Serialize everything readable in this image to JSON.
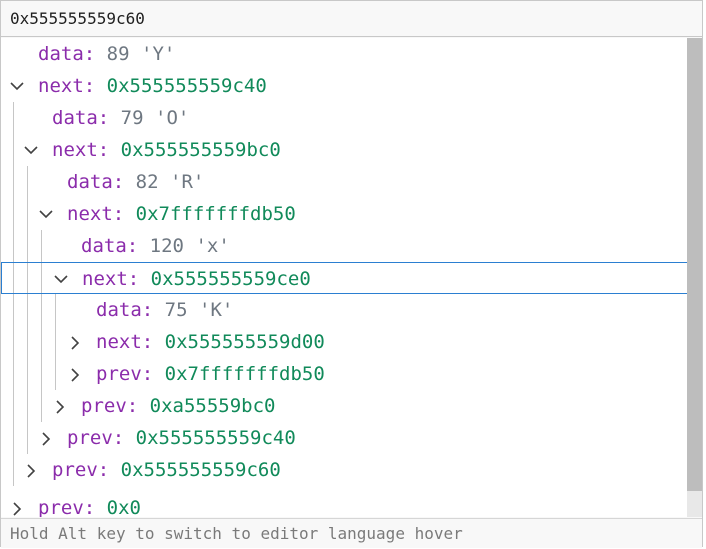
{
  "header": {
    "title": "0x555555559c60"
  },
  "rows": [
    {
      "kind": "leaf",
      "key": "data",
      "num": "89",
      "str": "'Y'"
    },
    {
      "kind": "expanded",
      "key": "next",
      "addr": "0x555555559c40"
    },
    {
      "kind": "leaf",
      "key": "data",
      "num": "79",
      "str": "'O'"
    },
    {
      "kind": "expanded",
      "key": "next",
      "addr": "0x555555559bc0"
    },
    {
      "kind": "leaf",
      "key": "data",
      "num": "82",
      "str": "'R'"
    },
    {
      "kind": "expanded",
      "key": "next",
      "addr": "0x7fffffffdb50"
    },
    {
      "kind": "leaf",
      "key": "data",
      "num": "120",
      "str": "'x'"
    },
    {
      "kind": "expanded",
      "key": "next",
      "addr": "0x555555559ce0",
      "selected": true
    },
    {
      "kind": "leaf",
      "key": "data",
      "num": "75",
      "str": "'K'"
    },
    {
      "kind": "collapsed",
      "key": "next",
      "addr": "0x555555559d00"
    },
    {
      "kind": "collapsed",
      "key": "prev",
      "addr": "0x7fffffffdb50"
    },
    {
      "kind": "collapsed",
      "key": "prev",
      "addr": "0xa55559bc0"
    },
    {
      "kind": "collapsed",
      "key": "prev",
      "addr": "0x555555559c40"
    },
    {
      "kind": "collapsed",
      "key": "prev",
      "addr": "0x555555559c60"
    },
    {
      "kind": "collapsed",
      "key": "prev",
      "addr": "0x0"
    }
  ],
  "footer": {
    "hint": "Hold Alt key to switch to editor language hover"
  },
  "colors": {
    "key": "#8b2cab",
    "address": "#118a5a",
    "value": "#6e7781",
    "selection_border": "#2b7fd1"
  }
}
